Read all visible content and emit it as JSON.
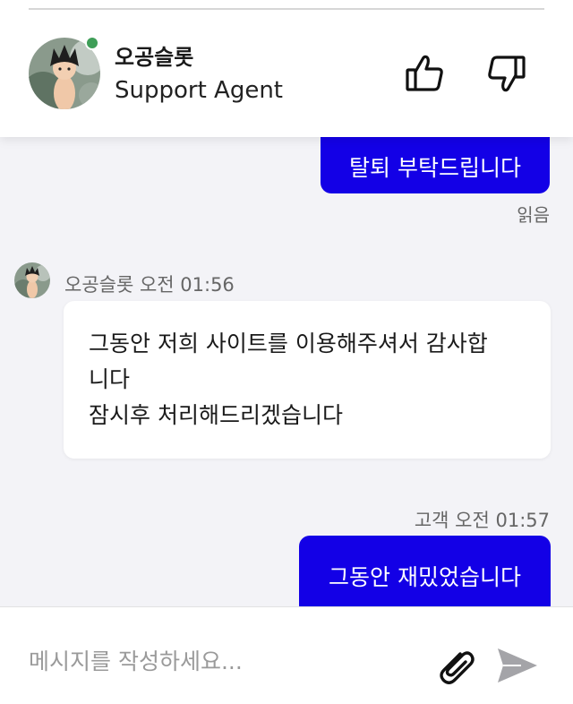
{
  "header": {
    "agent_name": "오공슬롯",
    "agent_role": "Support Agent",
    "online_color": "#3f9e58",
    "rate_up_icon": "thumbs-up-icon",
    "rate_down_icon": "thumbs-down-icon"
  },
  "messages": [
    {
      "sender": "customer",
      "text": "탈퇴 부탁드립니다",
      "status": "읽음"
    },
    {
      "sender": "agent",
      "meta": "오공슬롯 오전 01:56",
      "lines": [
        "그동안 저희 사이트를 이용해주셔서 감사합",
        "니다",
        "잠시후 처리해드리겠습니다"
      ]
    },
    {
      "sender": "customer",
      "meta": "고객 오전 01:57",
      "text": "그동안 재밌었습니다"
    }
  ],
  "composer": {
    "placeholder": "메시지를 작성하세요...",
    "value": "",
    "attach_icon": "paperclip-icon",
    "send_icon": "send-icon"
  },
  "colors": {
    "outgoing_bubble": "#1300e6",
    "background": "#f3f3f7"
  }
}
